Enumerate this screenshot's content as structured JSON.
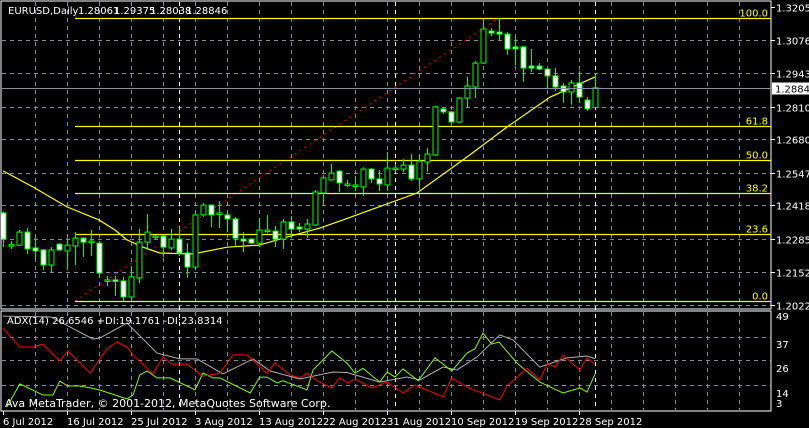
{
  "header": {
    "symbol": "EURUSD,Daily",
    "open": "1.28061",
    "high": "1.29375",
    "low": "1.28038",
    "close": "1.28846"
  },
  "indicator": {
    "label": "ADX(14) 26.6546 +DI:19.1761 -DI:23.8314"
  },
  "copyright": "Ava MetaTrader, © 2001-2012, MetaQuotes Software Corp.",
  "colors": {
    "background": "#000000",
    "candle": "#00ff00",
    "bear_fill": "#ffffff",
    "bull_fill": "#000000",
    "ma": "#ffff00",
    "fib": "#ffff00",
    "fib_trend": "#ff0000",
    "grid": "#7f8a99",
    "adx": "#b0b0b0",
    "plus_di": "#7fff00",
    "minus_di": "#ff0000",
    "text": "#ffffff"
  },
  "chart_data": {
    "type": "candlestick",
    "title": "EURUSD,Daily",
    "x_tick_labels": [
      {
        "bar": 0,
        "label": "6 Jul 2012"
      },
      {
        "bar": 8,
        "label": "16 Jul 2012"
      },
      {
        "bar": 16,
        "label": "25 Jul 2012"
      },
      {
        "bar": 24,
        "label": "3 Aug 2012"
      },
      {
        "bar": 32,
        "label": "13 Aug 2012"
      },
      {
        "bar": 40,
        "label": "22 Aug 2012"
      },
      {
        "bar": 48,
        "label": "31 Aug 2012"
      },
      {
        "bar": 56,
        "label": "10 Sep 2012"
      },
      {
        "bar": 64,
        "label": "19 Sep 2012"
      },
      {
        "bar": 72,
        "label": "28 Sep 2012"
      }
    ],
    "period_separators": [
      22,
      49,
      74
    ],
    "y_tick_labels": [
      "1.32055",
      "1.30760",
      "1.29430",
      "1.28100",
      "1.26805",
      "1.25475",
      "1.24180",
      "1.22850",
      "1.21520",
      "1.20225"
    ],
    "ylim": [
      1.20225,
      1.32055
    ],
    "current_price": "1.28846",
    "ohlc": [
      [
        1.2388,
        1.2395,
        1.2252,
        1.2284
      ],
      [
        1.226,
        1.2276,
        1.2245,
        1.2262
      ],
      [
        1.226,
        1.232,
        1.2257,
        1.2312
      ],
      [
        1.2312,
        1.2328,
        1.2225,
        1.2245
      ],
      [
        1.2249,
        1.2292,
        1.2205,
        1.2237
      ],
      [
        1.2241,
        1.2245,
        1.2161,
        1.2181
      ],
      [
        1.2181,
        1.2252,
        1.2153,
        1.2241
      ],
      [
        1.2264,
        1.2268,
        1.2237,
        1.2241
      ],
      [
        1.2237,
        1.2288,
        1.2165,
        1.226
      ],
      [
        1.2257,
        1.2312,
        1.2181,
        1.2288
      ],
      [
        1.2288,
        1.2292,
        1.2213,
        1.2272
      ],
      [
        1.2272,
        1.232,
        1.2217,
        1.2276
      ],
      [
        1.2268,
        1.2276,
        1.2134,
        1.2149
      ],
      [
        1.2118,
        1.2138,
        1.2098,
        1.2122
      ],
      [
        1.2122,
        1.2138,
        1.2058,
        1.2118
      ],
      [
        1.2118,
        1.2134,
        1.2038,
        1.2054
      ],
      [
        1.2054,
        1.2177,
        1.2042,
        1.2134
      ],
      [
        1.213,
        1.2324,
        1.211,
        1.2272
      ],
      [
        1.2272,
        1.2384,
        1.2241,
        1.2312
      ],
      [
        1.2292,
        1.23,
        1.2284,
        1.2296
      ],
      [
        1.2296,
        1.23,
        1.2213,
        1.2252
      ],
      [
        1.2249,
        1.2324,
        1.2241,
        1.2284
      ],
      [
        1.2284,
        1.2332,
        1.2217,
        1.2229
      ],
      [
        1.2229,
        1.2268,
        1.213,
        1.2173
      ],
      [
        1.2173,
        1.2384,
        1.2161,
        1.238
      ],
      [
        1.238,
        1.2427,
        1.2372,
        1.2419
      ],
      [
        1.2419,
        1.2423,
        1.2332,
        1.238
      ],
      [
        1.2384,
        1.2435,
        1.2328,
        1.2388
      ],
      [
        1.238,
        1.2396,
        1.2312,
        1.2364
      ],
      [
        1.2364,
        1.2372,
        1.2257,
        1.2288
      ],
      [
        1.2284,
        1.2312,
        1.2233,
        1.2276
      ],
      [
        1.2284,
        1.2288,
        1.2264,
        1.2268
      ],
      [
        1.2268,
        1.2368,
        1.2252,
        1.232
      ],
      [
        1.2316,
        1.238,
        1.2308,
        1.232
      ],
      [
        1.2316,
        1.2336,
        1.2252,
        1.2284
      ],
      [
        1.2284,
        1.2364,
        1.2245,
        1.2352
      ],
      [
        1.2352,
        1.2376,
        1.2288,
        1.2324
      ],
      [
        1.2332,
        1.2348,
        1.2312,
        1.2324
      ],
      [
        1.2324,
        1.2364,
        1.2288,
        1.2344
      ],
      [
        1.234,
        1.2479,
        1.2336,
        1.2471
      ],
      [
        1.2467,
        1.2539,
        1.2419,
        1.2527
      ],
      [
        1.2519,
        1.2582,
        1.2515,
        1.2546
      ],
      [
        1.2554,
        1.2558,
        1.2471,
        1.2507
      ],
      [
        1.2499,
        1.2519,
        1.2491,
        1.2503
      ],
      [
        1.2495,
        1.2535,
        1.2475,
        1.2499
      ],
      [
        1.2491,
        1.257,
        1.2455,
        1.2562
      ],
      [
        1.2562,
        1.2566,
        1.2507,
        1.2523
      ],
      [
        1.2523,
        1.2558,
        1.2475,
        1.2503
      ],
      [
        1.2499,
        1.263,
        1.2475,
        1.2566
      ],
      [
        1.2562,
        1.2582,
        1.255,
        1.2566
      ],
      [
        1.2562,
        1.2602,
        1.255,
        1.2578
      ],
      [
        1.2578,
        1.2622,
        1.2515,
        1.2523
      ],
      [
        1.2523,
        1.2618,
        1.2491,
        1.2594
      ],
      [
        1.259,
        1.2646,
        1.255,
        1.2622
      ],
      [
        1.2618,
        1.2813,
        1.2614,
        1.2809
      ],
      [
        1.2801,
        1.2805,
        1.2781,
        1.2789
      ],
      [
        1.2789,
        1.2793,
        1.2741,
        1.2749
      ],
      [
        1.2749,
        1.2848,
        1.2745,
        1.2844
      ],
      [
        1.2844,
        1.2928,
        1.2805,
        1.2892
      ],
      [
        1.2888,
        1.2991,
        1.2844,
        1.2983
      ],
      [
        1.2983,
        1.3158,
        1.2979,
        1.3118
      ],
      [
        1.311,
        1.3122,
        1.309,
        1.3102
      ],
      [
        1.3106,
        1.3162,
        1.3071,
        1.3098
      ],
      [
        1.3098,
        1.3106,
        1.3015,
        1.3039
      ],
      [
        1.3047,
        1.3082,
        1.2975,
        1.3039
      ],
      [
        1.3047,
        1.3051,
        1.2908,
        1.2963
      ],
      [
        1.2971,
        1.3039,
        1.2947,
        1.2963
      ],
      [
        1.2971,
        1.2983,
        1.2955,
        1.2959
      ],
      [
        1.2959,
        1.2963,
        1.288,
        1.2932
      ],
      [
        1.2932,
        1.2963,
        1.2872,
        1.2888
      ],
      [
        1.2892,
        1.2904,
        1.2825,
        1.2868
      ],
      [
        1.2868,
        1.2916,
        1.2817,
        1.2904
      ],
      [
        1.2904,
        1.2952,
        1.2825,
        1.2848
      ],
      [
        1.2836,
        1.2848,
        1.2793,
        1.2801
      ],
      [
        1.28061,
        1.29375,
        1.28038,
        1.28846
      ]
    ],
    "moving_average": [
      [
        0,
        1.2555
      ],
      [
        3.75,
        1.2491
      ],
      [
        8,
        1.2412
      ],
      [
        12,
        1.236
      ],
      [
        14,
        1.232
      ],
      [
        15.5,
        1.2281
      ],
      [
        17.5,
        1.2252
      ],
      [
        19.6,
        1.2229
      ],
      [
        23.75,
        1.2225
      ],
      [
        28,
        1.2252
      ],
      [
        32,
        1.226
      ],
      [
        35.5,
        1.2292
      ],
      [
        39.6,
        1.2328
      ],
      [
        42.5,
        1.236
      ],
      [
        51.75,
        1.2467
      ],
      [
        58,
        1.261
      ],
      [
        63,
        1.2729
      ],
      [
        68.4,
        1.2848
      ],
      [
        74,
        1.2928
      ]
    ],
    "fibonacci": {
      "from": {
        "bar": 9,
        "price": 1.2038
      },
      "to": {
        "bar": 62,
        "price": 1.3162
      },
      "levels": [
        {
          "ratio": 1.0,
          "label": "100.0"
        },
        {
          "ratio": 0.618,
          "label": "61.8"
        },
        {
          "ratio": 0.5,
          "label": "50.0"
        },
        {
          "ratio": 0.382,
          "label": "38.2"
        },
        {
          "ratio": 0.236,
          "label": "23.6"
        },
        {
          "ratio": 0.0,
          "label": "0.0"
        }
      ]
    },
    "adx_panel": {
      "y_tick_labels": [
        "49",
        "37",
        "26",
        "14",
        "3"
      ],
      "ylim": [
        3,
        49
      ],
      "adx": [
        [
          0,
          47
        ],
        [
          6,
          46.6
        ],
        [
          11.25,
          36
        ],
        [
          12.1,
          36.5
        ],
        [
          15.5,
          43.7
        ],
        [
          19.25,
          29.3
        ],
        [
          22.1,
          26.5
        ],
        [
          24.25,
          26.5
        ],
        [
          27.5,
          19.3
        ],
        [
          31.25,
          26.5
        ],
        [
          33.4,
          20.7
        ],
        [
          37.1,
          16.9
        ],
        [
          41.25,
          20.2
        ],
        [
          43,
          20
        ],
        [
          44.6,
          18.2
        ],
        [
          47.1,
          15.4
        ],
        [
          50.5,
          17.8
        ],
        [
          52.1,
          16.4
        ],
        [
          55,
          22.6
        ],
        [
          56.75,
          21.2
        ],
        [
          59.25,
          27.4
        ],
        [
          62.1,
          38
        ],
        [
          63.75,
          35.6
        ],
        [
          67.1,
          22.6
        ],
        [
          70.5,
          27
        ],
        [
          73,
          27.9
        ],
        [
          74,
          26.65
        ]
      ],
      "plus_di": [
        [
          0.5,
          3.5
        ],
        [
          2.1,
          14.5
        ],
        [
          5,
          9.2
        ],
        [
          6.25,
          9.2
        ],
        [
          7.1,
          15.9
        ],
        [
          8.1,
          13.5
        ],
        [
          9.6,
          13.5
        ],
        [
          10.9,
          12.6
        ],
        [
          12.1,
          11.6
        ],
        [
          15.5,
          7.3
        ],
        [
          16.25,
          9.2
        ],
        [
          17.1,
          18.8
        ],
        [
          18,
          20.7
        ],
        [
          19.25,
          17.4
        ],
        [
          20.9,
          17.4
        ],
        [
          24,
          11.6
        ],
        [
          25,
          19.7
        ],
        [
          26.25,
          17.4
        ],
        [
          27.1,
          17.4
        ],
        [
          30.9,
          10.2
        ],
        [
          32.1,
          17.8
        ],
        [
          33,
          17.8
        ],
        [
          34.25,
          15
        ],
        [
          35,
          16
        ],
        [
          37.1,
          13
        ],
        [
          38,
          11.6
        ],
        [
          38.75,
          21.2
        ],
        [
          41.1,
          30.3
        ],
        [
          43,
          24.5
        ],
        [
          44,
          19.7
        ],
        [
          45,
          22
        ],
        [
          47.1,
          15.4
        ],
        [
          48,
          20.2
        ],
        [
          49,
          17.8
        ],
        [
          50,
          21.7
        ],
        [
          51.9,
          16
        ],
        [
          54,
          27
        ],
        [
          56.1,
          20.7
        ],
        [
          58,
          29.3
        ],
        [
          59,
          31.3
        ],
        [
          60,
          38.9
        ],
        [
          61.1,
          33.6
        ],
        [
          62,
          34.6
        ],
        [
          64.25,
          24.5
        ],
        [
          67.1,
          15.4
        ],
        [
          70,
          10.2
        ],
        [
          72.1,
          12.6
        ],
        [
          73,
          10.6
        ],
        [
          74,
          19.18
        ]
      ],
      "minus_di": [
        [
          0,
          41.3
        ],
        [
          2.1,
          32.2
        ],
        [
          3.75,
          32.2
        ],
        [
          5,
          33.6
        ],
        [
          7.1,
          25.5
        ],
        [
          8.1,
          30.3
        ],
        [
          10.9,
          19.7
        ],
        [
          13,
          31.3
        ],
        [
          14.25,
          34.6
        ],
        [
          15.5,
          32.2
        ],
        [
          16.25,
          28.4
        ],
        [
          18.75,
          19.3
        ],
        [
          20,
          27.4
        ],
        [
          21.1,
          24
        ],
        [
          23,
          24
        ],
        [
          25,
          18.2
        ],
        [
          27.1,
          19.7
        ],
        [
          28.75,
          28.4
        ],
        [
          30.5,
          28.4
        ],
        [
          33,
          19.7
        ],
        [
          34,
          24.5
        ],
        [
          35.9,
          18.8
        ],
        [
          37.1,
          17.4
        ],
        [
          38.1,
          19.7
        ],
        [
          39.25,
          16
        ],
        [
          41.1,
          12.6
        ],
        [
          42.1,
          17.4
        ],
        [
          43.1,
          15
        ],
        [
          44,
          16.9
        ],
        [
          46.1,
          12.6
        ],
        [
          48,
          15.4
        ],
        [
          50,
          10.2
        ],
        [
          51.5,
          14
        ],
        [
          55,
          8.3
        ],
        [
          56.1,
          17.4
        ],
        [
          58,
          13
        ],
        [
          62.1,
          6.8
        ],
        [
          63,
          13.5
        ],
        [
          64.25,
          17.8
        ],
        [
          65.5,
          22.1
        ],
        [
          67.1,
          16.4
        ],
        [
          68.1,
          24.5
        ],
        [
          69,
          22.6
        ],
        [
          70,
          28.4
        ],
        [
          72.1,
          21.2
        ],
        [
          73,
          27
        ],
        [
          74,
          23.83
        ]
      ]
    }
  }
}
